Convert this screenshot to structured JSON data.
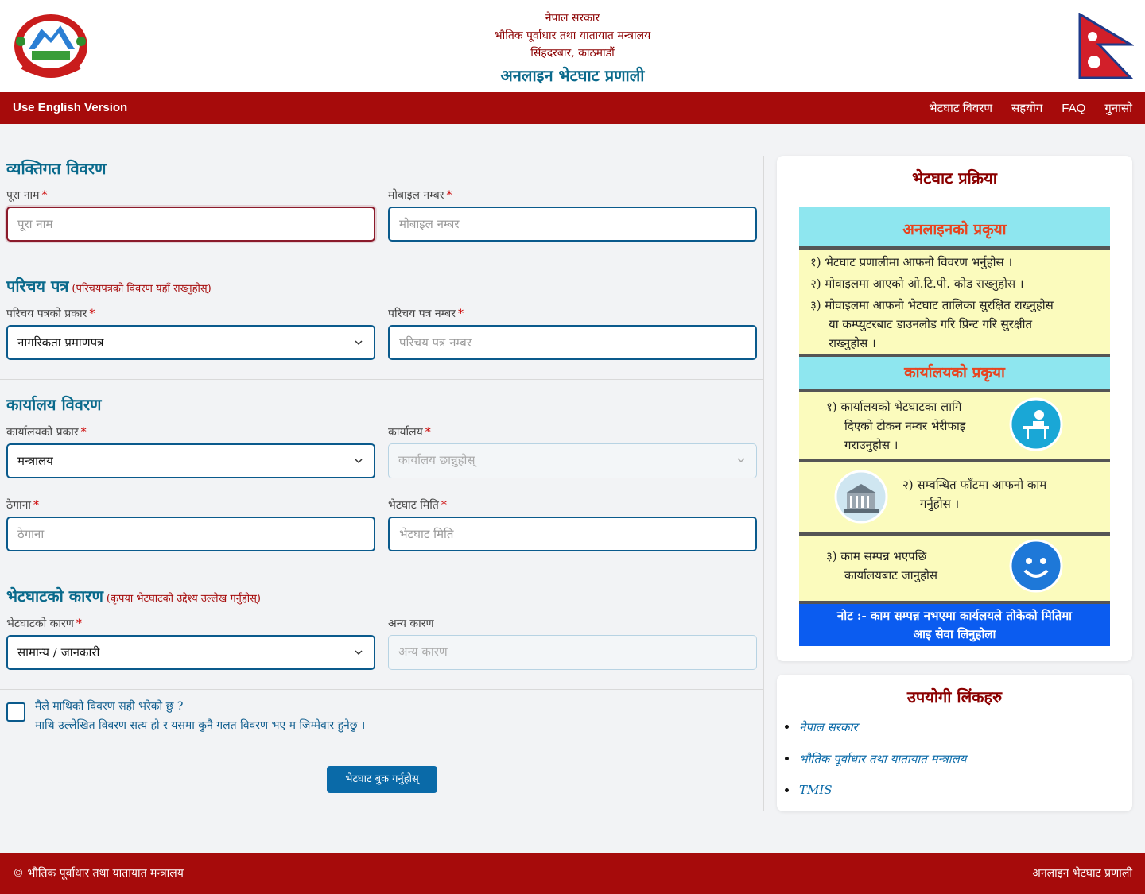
{
  "header": {
    "line1": "नेपाल सरकार",
    "line2": "भौतिक पूर्वाधार तथा यातायात मन्त्रालय",
    "line3": "सिंहदरबार, काठमाडौं",
    "main_title": "अनलाइन भेटघाट प्रणाली"
  },
  "navbar": {
    "english_link": "Use English Version",
    "items": [
      "भेटघाट विवरण",
      "सहयोग",
      "FAQ",
      "गुनासो"
    ]
  },
  "form": {
    "sections": [
      {
        "title": "व्यक्तिगत विवरण",
        "note": ""
      },
      {
        "title": "परिचय पत्र",
        "note": "(परिचयपत्रको विवरण यहाँ राख्नुहोस्)"
      },
      {
        "title": "कार्यालय विवरण",
        "note": ""
      },
      {
        "title": "भेटघाटको कारण",
        "note": "(कृपया भेटघाटको उद्देश्य उल्लेख गर्नुहोस्)"
      }
    ],
    "fields": {
      "full_name": {
        "label": "पूरा नाम",
        "placeholder": "पूरा नाम"
      },
      "mobile": {
        "label": "मोबाइल नम्बर",
        "placeholder": "मोबाइल नम्बर"
      },
      "id_type": {
        "label": "परिचय पत्रको प्रकार",
        "value": "नागरिकता प्रमाणपत्र"
      },
      "id_number": {
        "label": "परिचय पत्र नम्बर",
        "placeholder": "परिचय पत्र नम्बर"
      },
      "office_type": {
        "label": "कार्यालयको प्रकार",
        "value": "मन्त्रालय"
      },
      "office": {
        "label": "कार्यालय",
        "placeholder": "कार्यालय छान्नुहोस्"
      },
      "address": {
        "label": "ठेगाना",
        "placeholder": "ठेगाना"
      },
      "visit_date": {
        "label": "भेटघाट मिति",
        "placeholder": "भेटघाट मिति"
      },
      "reason": {
        "label": "भेटघाटको कारण",
        "value": "सामान्य / जानकारी"
      },
      "other_reason": {
        "label": "अन्य कारण",
        "placeholder": "अन्य कारण"
      }
    },
    "checkbox_line1": "मैले माथिको विवरण सही भरेको छु ?",
    "checkbox_line2": "माथि उल्लेखित विवरण सत्य हो र यसमा कुनै गलत विवरण भए म जिम्मेवार हुनेछु ।",
    "submit_label": "भेटघाट बुक गर्नुहोस्"
  },
  "process_card": {
    "title": "भेटघाट प्रक्रिया",
    "online_heading": "अनलाइनको प्रकृया",
    "online_steps": [
      "१) भेटघाट प्रणालीमा आफनो विवरण भर्नुहोस ।",
      "२) मोवाइलमा आएको ओ.टि.पी. कोड राख्नुहोस ।",
      "३) मोवाइलमा आफनो भेटघाट तालिका सुरक्षित राख्नुहोस",
      "या कम्प्युटरबाट डाउनलोड गरि प्रिन्ट गरि सुरक्षीत",
      "राख्नुहोस ।"
    ],
    "office_heading": "कार्यालयको प्रकृया",
    "office_step1": [
      "१) कार्यालयको भेटघाटका लागि",
      "दिएको टोकन नम्वर भेरीफाइ",
      "गराउनुहोस ।"
    ],
    "office_step2": [
      "२) सम्वन्धित फाँटमा आफनो काम",
      "गर्नुहोस ।"
    ],
    "office_step3": [
      "३) काम सम्पन्न भएपछि",
      "कार्यालयबाट जानुहोस"
    ],
    "note": [
      "नोट :- काम सम्पन्न नभएमा कार्यलयले तोकेको मितिमा",
      "आइ सेवा लिनुहोला"
    ]
  },
  "links_card": {
    "title": "उपयोगी लिंकहरु",
    "links": [
      "नेपाल सरकार",
      "भौतिक पूर्वाधार तथा यातायात मन्त्रालय",
      "TMIS"
    ]
  },
  "footer": {
    "left": "© भौतिक पूर्वाधार तथा यातायात मन्त्रालय",
    "right": "अनलाइन भेटघाट प्रणाली"
  },
  "colors": {
    "brand_red": "#a60b0b",
    "brand_blue": "#0a6a8c"
  }
}
